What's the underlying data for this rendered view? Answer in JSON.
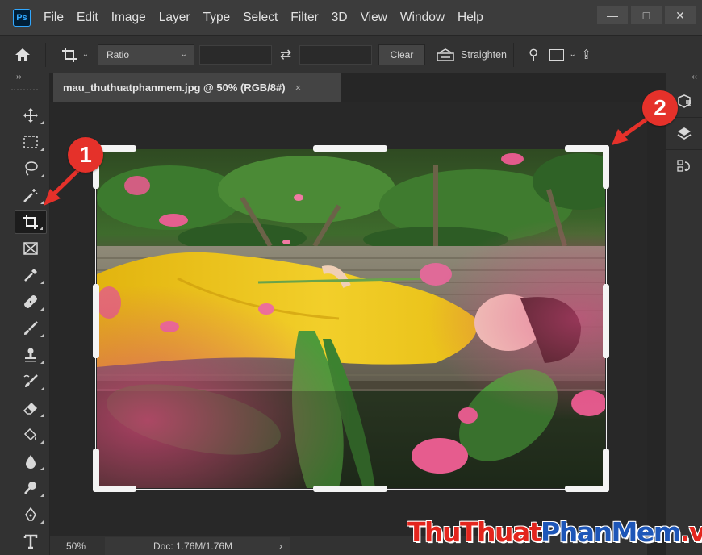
{
  "app": {
    "logo_text": "Ps"
  },
  "menu": {
    "items": [
      "File",
      "Edit",
      "Image",
      "Layer",
      "Type",
      "Select",
      "Filter",
      "3D",
      "View",
      "Window",
      "Help"
    ]
  },
  "window_controls": {
    "minimize": "—",
    "maximize": "□",
    "close": "✕"
  },
  "options_bar": {
    "crop_ratio": "Ratio",
    "width_value": "",
    "height_value": "",
    "clear_label": "Clear",
    "straighten_label": "Straighten"
  },
  "toolbar": {
    "collapse": "››",
    "active_tool": "crop-tool",
    "tools": [
      "move-tool",
      "marquee-tool",
      "lasso-tool",
      "magic-wand-tool",
      "crop-tool",
      "frame-tool",
      "eyedropper-tool",
      "healing-brush-tool",
      "brush-tool",
      "clone-stamp-tool",
      "history-brush-tool",
      "eraser-tool",
      "paint-bucket-tool",
      "blur-tool",
      "dodge-tool",
      "pen-tool",
      "type-tool"
    ]
  },
  "document": {
    "tab_title": "mau_thuthuatphanmem.jpg @ 50% (RGB/8#)",
    "tab_close": "×"
  },
  "status_bar": {
    "zoom": "50%",
    "doc_info": "Doc: 1.76M/1.76M",
    "arrow": "›"
  },
  "right_panel": {
    "collapse": "‹‹"
  },
  "annotations": [
    {
      "label": "1"
    },
    {
      "label": "2"
    }
  ],
  "watermark": {
    "part1": "ThuThuat",
    "part2": "PhanMem",
    "part3": ".vn"
  },
  "colors": {
    "accent_red": "#e5312a",
    "ps_blue": "#31a8ff",
    "watermark_red": "#e3251d",
    "watermark_blue": "#1d56b8"
  }
}
